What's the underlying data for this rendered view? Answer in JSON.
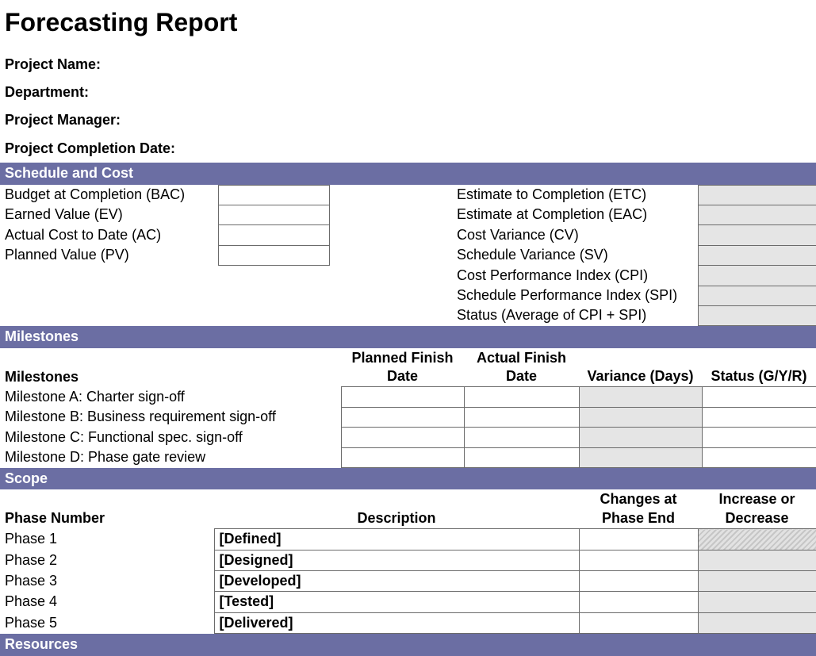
{
  "title": "Forecasting Report",
  "meta": {
    "project_name": "Project Name:",
    "department": "Department:",
    "project_manager": "Project Manager:",
    "completion_date": "Project Completion Date:"
  },
  "schedule_cost": {
    "header": "Schedule and Cost",
    "left": [
      "Budget at Completion (BAC)",
      "Earned Value (EV)",
      "Actual Cost to Date (AC)",
      "Planned Value (PV)"
    ],
    "right": [
      "Estimate to Completion (ETC)",
      "Estimate at Completion (EAC)",
      "Cost Variance (CV)",
      "Schedule Variance (SV)",
      "Cost Performance Index (CPI)",
      "Schedule Performance Index (SPI)",
      "Status (Average of CPI + SPI)"
    ]
  },
  "milestones": {
    "header": "Milestones",
    "columns": {
      "c0": "Milestones",
      "c1": "Planned Finish Date",
      "c2": "Actual Finish Date",
      "c3": "Variance (Days)",
      "c4": "Status (G/Y/R)"
    },
    "rows": [
      "Milestone A: Charter sign-off",
      "Milestone B: Business requirement sign-off",
      "Milestone C: Functional spec. sign-off",
      "Milestone D: Phase gate review"
    ]
  },
  "scope": {
    "header": "Scope",
    "columns": {
      "c0": "Phase Number",
      "c1": "Description",
      "c2": "Changes at Phase End",
      "c3": "Increase or Decrease"
    },
    "rows": [
      {
        "phase": "Phase 1",
        "desc": "[Defined]"
      },
      {
        "phase": "Phase 2",
        "desc": "[Designed]"
      },
      {
        "phase": "Phase 3",
        "desc": "[Developed]"
      },
      {
        "phase": "Phase 4",
        "desc": "[Tested]"
      },
      {
        "phase": "Phase 5",
        "desc": "[Delivered]"
      }
    ]
  },
  "resources": {
    "header": "Resources"
  }
}
